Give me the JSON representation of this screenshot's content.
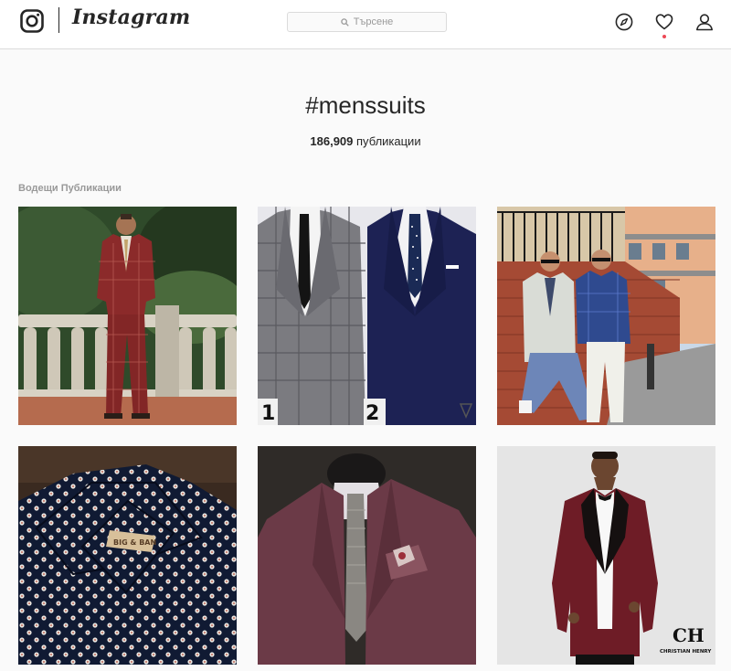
{
  "header": {
    "brand": "Instagram",
    "search": {
      "placeholder": "Търсене"
    },
    "nav": {
      "notification_color": "#ed4956"
    }
  },
  "hashtag": {
    "title": "#menssuits",
    "post_count": "186,909",
    "post_count_label": "публикации"
  },
  "top_posts": {
    "title": "Водещи Публикации",
    "posts": [
      {
        "alt_icon": "man-in-burgundy-plaid-suit-photo"
      },
      {
        "alt_icon": "two-suits-comparison-photo",
        "labels": [
          "1",
          "2"
        ]
      },
      {
        "alt_icon": "two-men-in-suits-photo"
      },
      {
        "alt_icon": "polka-dot-shirt-photo",
        "tag_text": "BIG & BAN"
      },
      {
        "alt_icon": "burgundy-jacket-mannequin-photo"
      },
      {
        "alt_icon": "burgundy-tuxedo-model-photo",
        "brand_mark": "CH",
        "brand_name": "CHRISTIAN HENRY"
      }
    ]
  },
  "colors": {
    "background": "#fafafa",
    "header_bg": "#ffffff",
    "border": "#dbdbdb",
    "text": "#262626",
    "muted": "#999999"
  }
}
